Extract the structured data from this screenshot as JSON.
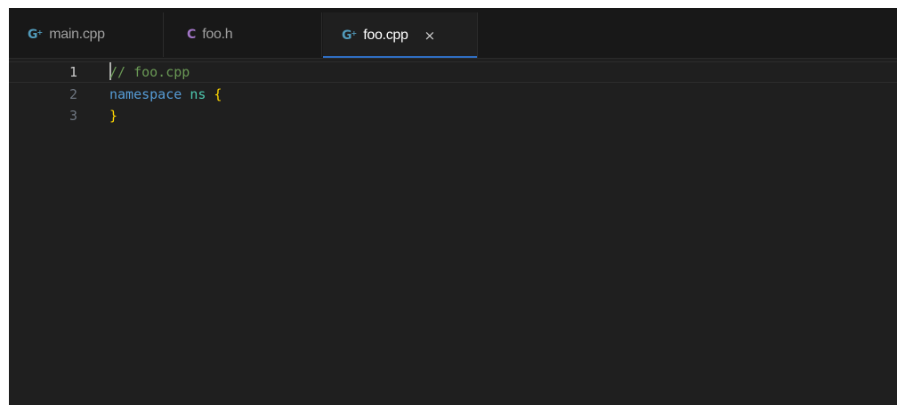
{
  "tabs": [
    {
      "label": "main.cpp",
      "icon": "cpp-file-icon",
      "icon_text": "G",
      "icon_color": "#519aba",
      "active": false
    },
    {
      "label": "foo.h",
      "icon": "c-header-file-icon",
      "icon_text": "C",
      "icon_color": "#a074c4",
      "active": false
    },
    {
      "label": "foo.cpp",
      "icon": "cpp-file-icon",
      "icon_text": "G",
      "icon_color": "#519aba",
      "active": true,
      "close": "×"
    }
  ],
  "editor": {
    "current_line": 1,
    "lines": [
      {
        "number": "1",
        "tokens": [
          {
            "text": "// foo.cpp",
            "type": "comment"
          }
        ]
      },
      {
        "number": "2",
        "tokens": [
          {
            "text": "namespace",
            "type": "keyword"
          },
          {
            "text": " ",
            "type": "space"
          },
          {
            "text": "ns",
            "type": "name"
          },
          {
            "text": " ",
            "type": "space"
          },
          {
            "text": "{",
            "type": "brace"
          }
        ]
      },
      {
        "number": "3",
        "tokens": [
          {
            "text": "}",
            "type": "brace"
          }
        ]
      }
    ]
  },
  "colors": {
    "accent": "#2f6fc4",
    "editor_bg": "#1f1f1f",
    "tabbar_bg": "#181818"
  }
}
